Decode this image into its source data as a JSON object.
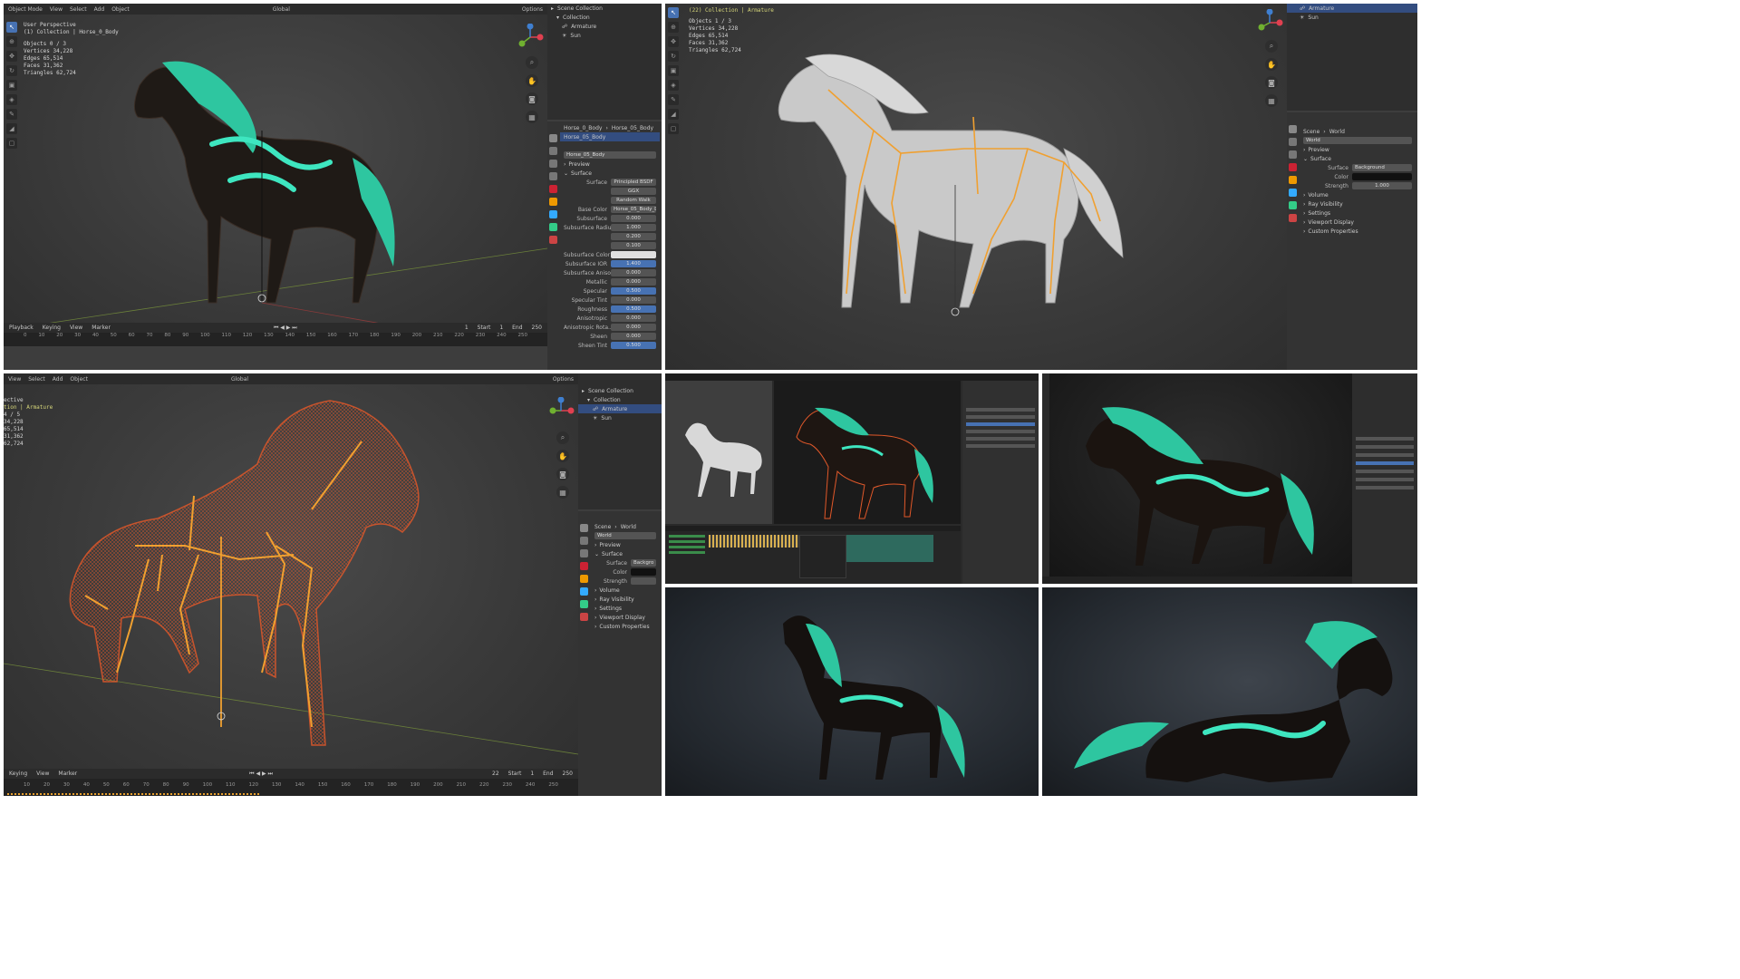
{
  "colors": {
    "accent": "#4772b3",
    "mane": "#2ec6a0",
    "glow": "#3ee6c0",
    "bone": "#f0a030",
    "wire": "#e0582a",
    "selected_text": "#d6d67a"
  },
  "panel1": {
    "mode": "Object Mode",
    "menu": [
      "View",
      "Select",
      "Add",
      "Object"
    ],
    "orient": "Global",
    "options": "Options",
    "overlay_title": "User Perspective",
    "overlay_sub": "(1) Collection | Horse_0_Body",
    "stats": [
      [
        "Objects",
        "0 / 3"
      ],
      [
        "Vertices",
        "34,228"
      ],
      [
        "Edges",
        "65,514"
      ],
      [
        "Faces",
        "31,362"
      ],
      [
        "Triangles",
        "62,724"
      ]
    ],
    "outliner": [
      "Scene Collection",
      "Collection",
      "Armature",
      "Sun"
    ],
    "mat_header": [
      "Horse_0_Body",
      "Horse_05_Body"
    ],
    "mat_slot": "Horse_05_Body",
    "mat_name": "Horse_05_Body",
    "sections": [
      "Preview",
      "Surface"
    ],
    "props": [
      {
        "l": "Surface",
        "v": "Principled BSDF",
        "k": "plain"
      },
      {
        "l": "",
        "v": "GGX",
        "k": "plain"
      },
      {
        "l": "",
        "v": "Random Walk",
        "k": "plain"
      },
      {
        "l": "Base Color",
        "v": "Horse_05_Body_Diffuse",
        "k": "plain"
      },
      {
        "l": "Subsurface",
        "v": "0.000",
        "k": "plain"
      },
      {
        "l": "Subsurface Radius",
        "v": "1.000",
        "k": "plain"
      },
      {
        "l": "",
        "v": "0.200",
        "k": "plain"
      },
      {
        "l": "",
        "v": "0.100",
        "k": "plain"
      },
      {
        "l": "Subsurface Color",
        "v": "",
        "k": "white"
      },
      {
        "l": "Subsurface IOR",
        "v": "1.400",
        "k": "blue"
      },
      {
        "l": "Subsurface Aniso...",
        "v": "0.000",
        "k": "plain"
      },
      {
        "l": "Metallic",
        "v": "0.000",
        "k": "plain"
      },
      {
        "l": "Specular",
        "v": "0.500",
        "k": "blue"
      },
      {
        "l": "Specular Tint",
        "v": "0.000",
        "k": "plain"
      },
      {
        "l": "Roughness",
        "v": "0.500",
        "k": "blue"
      },
      {
        "l": "Anisotropic",
        "v": "0.000",
        "k": "plain"
      },
      {
        "l": "Anisotropic Rota...",
        "v": "0.000",
        "k": "plain"
      },
      {
        "l": "Sheen",
        "v": "0.000",
        "k": "plain"
      },
      {
        "l": "Sheen Tint",
        "v": "0.500",
        "k": "blue"
      }
    ],
    "timeline": {
      "menu": [
        "Playback",
        "Keying",
        "View",
        "Marker"
      ],
      "frame": "1",
      "start_label": "Start",
      "start": "1",
      "end_label": "End",
      "end": "250",
      "ticks": [
        "0",
        "10",
        "20",
        "30",
        "40",
        "50",
        "60",
        "70",
        "80",
        "90",
        "100",
        "110",
        "120",
        "130",
        "140",
        "150",
        "160",
        "170",
        "180",
        "190",
        "200",
        "210",
        "220",
        "230",
        "240",
        "250"
      ]
    }
  },
  "panel2": {
    "overlay_title": "(22) Collection | Armature",
    "stats": [
      [
        "Objects",
        "1 / 3"
      ],
      [
        "Vertices",
        "34,228"
      ],
      [
        "Edges",
        "65,514"
      ],
      [
        "Faces",
        "31,362"
      ],
      [
        "Triangles",
        "62,724"
      ]
    ],
    "outliner": [
      "Armature",
      "Sun"
    ],
    "world_header": [
      "Scene",
      "World"
    ],
    "world_name": "World",
    "sections": [
      "Preview",
      "Surface"
    ],
    "props": [
      {
        "l": "Surface",
        "v": "Background"
      },
      {
        "l": "Color",
        "v": ""
      },
      {
        "l": "Strength",
        "v": "1.000"
      }
    ],
    "more": [
      "Volume",
      "Ray Visibility",
      "Settings",
      "Viewport Display",
      "Custom Properties"
    ]
  },
  "panel3": {
    "menu": [
      "View",
      "Select",
      "Add",
      "Object"
    ],
    "orient": "Global",
    "options": "Options",
    "overlay_title": "ective",
    "overlay_sub": "tion | Armature",
    "stats": [
      "4 / 5",
      "34,228",
      "65,514",
      "31,362",
      "62,724"
    ],
    "outliner": [
      "Scene Collection",
      "Collection",
      "Armature",
      "Sun"
    ],
    "world_header": [
      "Scene",
      "World"
    ],
    "world_name": "World",
    "sections": [
      "Preview",
      "Surface"
    ],
    "props": [
      {
        "l": "Surface",
        "v": "Backgro"
      },
      {
        "l": "Color",
        "v": ""
      },
      {
        "l": "Strength",
        "v": ""
      }
    ],
    "more": [
      "Volume",
      "Ray Visibility",
      "Settings",
      "Viewport Display",
      "Custom Properties"
    ],
    "timeline": {
      "menu": [
        "Keying",
        "View",
        "Marker"
      ],
      "frame": "22",
      "start_label": "Start",
      "start": "1",
      "end_label": "End",
      "end": "250",
      "ticks": [
        "10",
        "20",
        "30",
        "40",
        "50",
        "60",
        "70",
        "80",
        "90",
        "100",
        "110",
        "120",
        "130",
        "140",
        "150",
        "160",
        "170",
        "180",
        "190",
        "200",
        "210",
        "220",
        "230",
        "240",
        "250"
      ]
    }
  }
}
